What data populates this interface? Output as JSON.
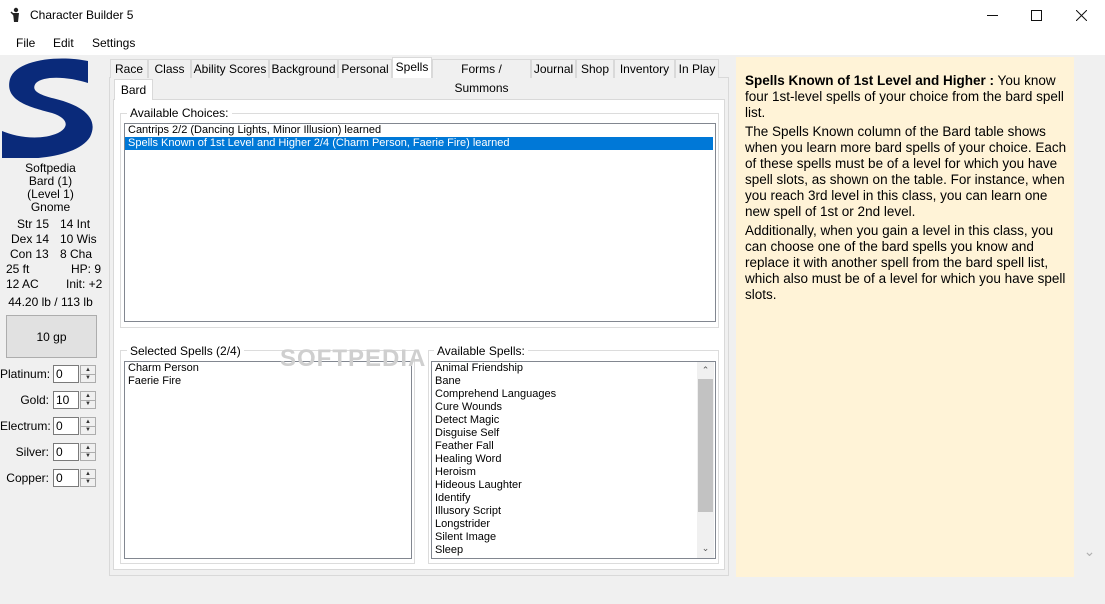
{
  "window": {
    "title": "Character Builder 5",
    "minimize_icon": "minimize-icon",
    "maximize_icon": "maximize-icon",
    "close_icon": "close-icon"
  },
  "menu": [
    "File",
    "Edit",
    "Settings"
  ],
  "character": {
    "name": "Softpedia",
    "class_line": "Bard (1)",
    "level_line": "(Level 1)",
    "race": "Gnome",
    "str": "Str 15",
    "int": "14 Int",
    "dex": "Dex 14",
    "wis": "10 Wis",
    "con": "Con 13",
    "cha": "8 Cha",
    "speed": "25 ft",
    "hp": "HP: 9",
    "ac": "12 AC",
    "init": "Init: +2",
    "weight": "44.20 lb / 113 lb",
    "gp_total": "10 gp"
  },
  "coins": [
    {
      "label": "Platinum:",
      "value": "0"
    },
    {
      "label": "Gold:",
      "value": "10"
    },
    {
      "label": "Electrum:",
      "value": "0"
    },
    {
      "label": "Silver:",
      "value": "0"
    },
    {
      "label": "Copper:",
      "value": "0"
    }
  ],
  "tabs": [
    "Race",
    "Class",
    "Ability Scores",
    "Background",
    "Personal",
    "Spells",
    "Forms / Summons",
    "Journal",
    "Shop",
    "Inventory",
    "In Play"
  ],
  "active_tab": "Spells",
  "subtab": "Bard",
  "available_choices": {
    "label": "Available Choices:",
    "items": [
      "Cantrips 2/2 (Dancing Lights, Minor Illusion) learned",
      "Spells Known of 1st Level and Higher  2/4 (Charm Person, Faerie Fire) learned"
    ],
    "selected_index": 1
  },
  "selected_spells": {
    "label": "Selected Spells (2/4)",
    "items": [
      "Charm Person",
      "Faerie Fire"
    ]
  },
  "available_spells": {
    "label": "Available Spells:",
    "items": [
      "Animal Friendship",
      "Bane",
      "Comprehend Languages",
      "Cure Wounds",
      "Detect Magic",
      "Disguise Self",
      "Feather Fall",
      "Healing Word",
      "Heroism",
      "Hideous Laughter",
      "Identify",
      "Illusory Script",
      "Longstrider",
      "Silent Image",
      "Sleep"
    ]
  },
  "description": {
    "heading": "Spells Known of 1st Level and Higher :",
    "p1_rest": " You know four 1st-level spells of your choice from the bard spell list.",
    "p2": "The Spells Known column of the Bard table shows when you learn more bard spells of your choice. Each of these spells must be of a level for which you have spell slots, as shown on the table. For instance, when you reach 3rd level in this class, you can learn one new spell of 1st or 2nd level.",
    "p3": "Additionally, when you gain a level in this class, you can choose one of the bard spells you know and replace it with another spell from the bard spell list, which also must be of a level for which you have spell slots."
  },
  "watermark": "SOFTPEDIA",
  "colors": {
    "logo": "#0a2a7a",
    "selection": "#0078d7",
    "description_bg": "#fff3d7"
  }
}
